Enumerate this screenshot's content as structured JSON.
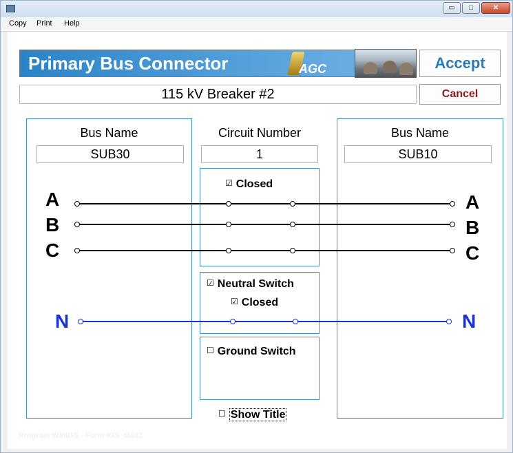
{
  "window": {
    "title": "",
    "minimize": "▭",
    "maximize": "□",
    "close": "✕"
  },
  "menu": [
    "Copy",
    "Print",
    "Help"
  ],
  "header": {
    "title": "Primary Bus Connector",
    "logo_text": "AGC"
  },
  "accept_label": "Accept",
  "cancel_label": "Cancel",
  "subtitle": "115 kV Breaker #2",
  "left_bus": {
    "label": "Bus Name",
    "value": "SUB30"
  },
  "circuit": {
    "label": "Circuit Number",
    "value": "1"
  },
  "right_bus": {
    "label": "Bus Name",
    "value": "SUB10"
  },
  "phases": [
    "A",
    "B",
    "C"
  ],
  "neutral_label": "N",
  "breaker_closed": {
    "label": "Closed",
    "checked": true,
    "mark": "☑"
  },
  "neutral_switch": {
    "label": "Neutral Switch",
    "checked": true,
    "mark": "☑"
  },
  "neutral_closed": {
    "label": "Closed",
    "checked": true,
    "mark": "☑"
  },
  "ground_switch": {
    "label": "Ground Switch",
    "checked": false,
    "mark": "☐"
  },
  "show_title": {
    "label": "Show Title",
    "checked": false,
    "mark": "☐"
  },
  "status_text": "Program WinIGS - Form IGS_M192",
  "colors": {
    "phase_line": "#000000",
    "neutral_line": "#1533d6",
    "panel_border": "#3d8dc9"
  }
}
